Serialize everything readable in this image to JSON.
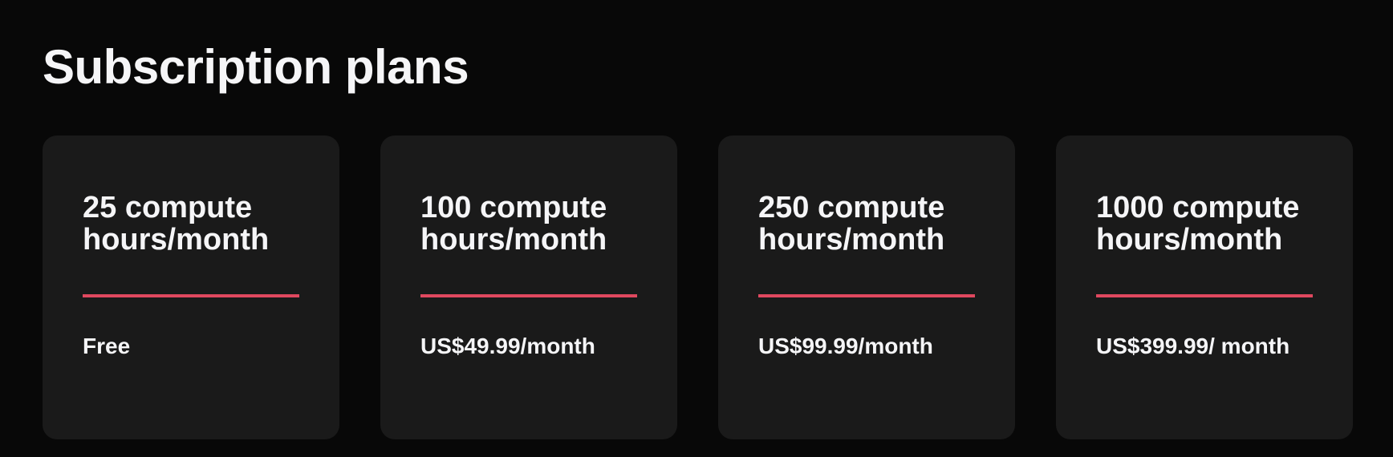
{
  "page": {
    "title": "Subscription plans"
  },
  "theme": {
    "background": "#080808",
    "card_background": "#1a1a1a",
    "accent": "#e0485f",
    "text": "#f5f5f7"
  },
  "plans": [
    {
      "title": "25 compute hours/month",
      "price": "Free"
    },
    {
      "title": "100 compute hours/month",
      "price": "US$49.99/month"
    },
    {
      "title": "250 compute hours/month",
      "price": "US$99.99/month"
    },
    {
      "title": "1000 compute hours/month",
      "price": "US$399.99/ month"
    }
  ]
}
